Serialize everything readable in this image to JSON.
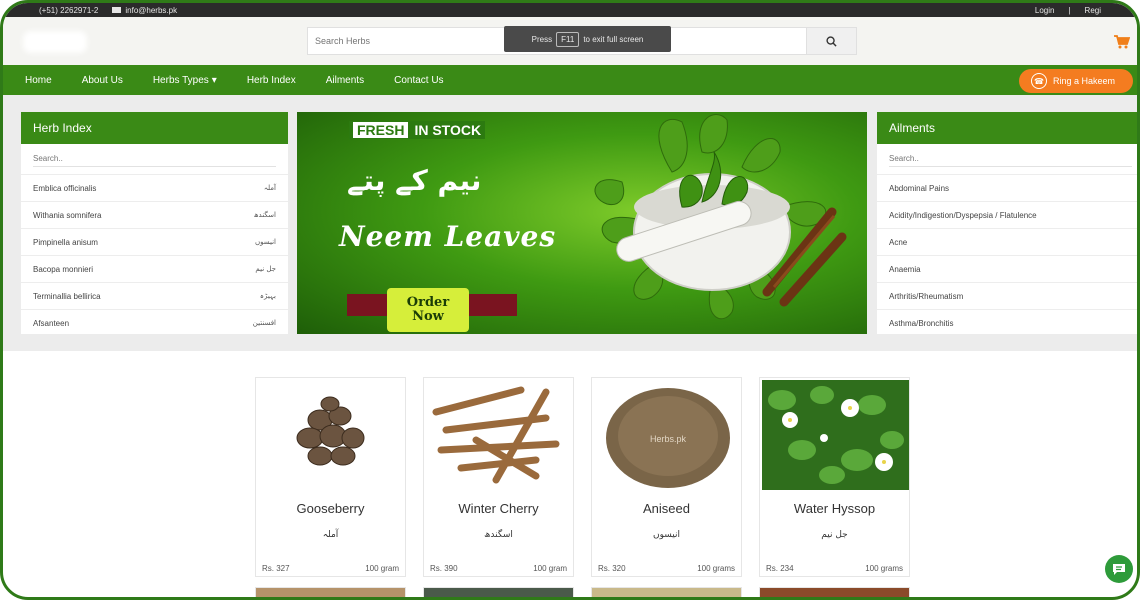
{
  "topbar": {
    "phone": "(+51) 2262971-2",
    "email": "info@herbs.pk",
    "login": "Login",
    "separator": "|",
    "register": "Regi"
  },
  "header": {
    "search_placeholder": "Search Herbs",
    "fullscreen_press": "Press",
    "fullscreen_key": "F11",
    "fullscreen_text": "to exit full screen"
  },
  "nav": {
    "items": [
      {
        "label": "Home"
      },
      {
        "label": "About Us"
      },
      {
        "label": "Herbs Types"
      },
      {
        "label": "Herb Index"
      },
      {
        "label": "Ailments"
      },
      {
        "label": "Contact Us"
      }
    ],
    "ring_button": "Ring a Hakeem"
  },
  "herb_index": {
    "title": "Herb Index",
    "search_placeholder": "Search..",
    "rows": [
      {
        "name": "Emblica officinalis",
        "urdu": "آملہ"
      },
      {
        "name": "Withania somnifera",
        "urdu": "اسگندھ"
      },
      {
        "name": "Pimpinella anisum",
        "urdu": "انیسوں"
      },
      {
        "name": "Bacopa monnieri",
        "urdu": "جل نیم"
      },
      {
        "name": "Terminallia bellirica",
        "urdu": "بہیڑہ"
      },
      {
        "name": "Afsanteen",
        "urdu": "افسنتین"
      }
    ]
  },
  "banner": {
    "fresh": "FRESH",
    "in_stock": "IN STOCK",
    "urdu_title": "نیم کے پتے",
    "title": "Neem Leaves",
    "order_line1": "Order",
    "order_line2": "Now"
  },
  "ailments": {
    "title": "Ailments",
    "search_placeholder": "Search..",
    "rows": [
      "Abdominal Pains",
      "Acidity/Indigestion/Dyspepsia / Flatulence",
      "Acne",
      "Anaemia",
      "Arthritis/Rheumatism",
      "Asthma/Bronchitis"
    ]
  },
  "products": [
    {
      "name": "Gooseberry",
      "urdu": "آملہ",
      "price": "Rs. 327",
      "weight": "100 gram"
    },
    {
      "name": "Winter Cherry",
      "urdu": "اسگندھ",
      "price": "Rs. 390",
      "weight": "100 gram"
    },
    {
      "name": "Aniseed",
      "urdu": "انیسوں",
      "price": "Rs. 320",
      "weight": "100 grams",
      "watermark": "Herbs.pk"
    },
    {
      "name": "Water Hyssop",
      "urdu": "جل نیم",
      "price": "Rs. 234",
      "weight": "100 grams"
    }
  ],
  "colors": {
    "brand_green": "#3a8a16",
    "accent_orange": "#f47c20",
    "topbar": "#2b2b2b"
  },
  "icons": [
    "phone-icon",
    "email-icon",
    "search-icon",
    "cart-icon",
    "caret-down-icon",
    "ring-icon",
    "chat-icon"
  ]
}
